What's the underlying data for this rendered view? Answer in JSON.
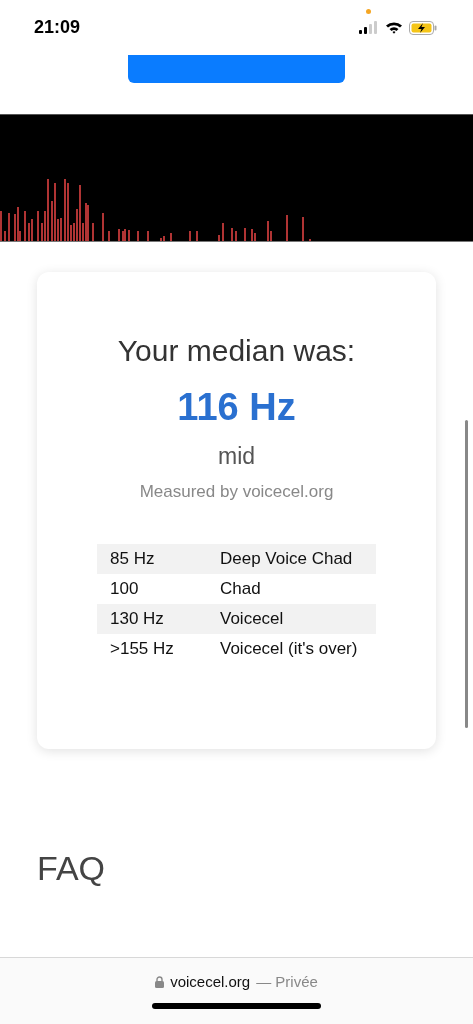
{
  "status_bar": {
    "time": "21:09"
  },
  "result": {
    "heading": "Your median was:",
    "value": "116 Hz",
    "category": "mid",
    "credit": "Measured by voicecel.org"
  },
  "table": {
    "rows": [
      {
        "frequency": "85 Hz",
        "label": "Deep Voice Chad"
      },
      {
        "frequency": "100",
        "label": "Chad"
      },
      {
        "frequency": "130 Hz",
        "label": "Voicecel"
      },
      {
        "frequency": ">155 Hz",
        "label": "Voicecel (it's over)"
      }
    ]
  },
  "faq": {
    "heading": "FAQ"
  },
  "browser_bar": {
    "domain": "voicecel.org",
    "mode": "— Privée"
  }
}
